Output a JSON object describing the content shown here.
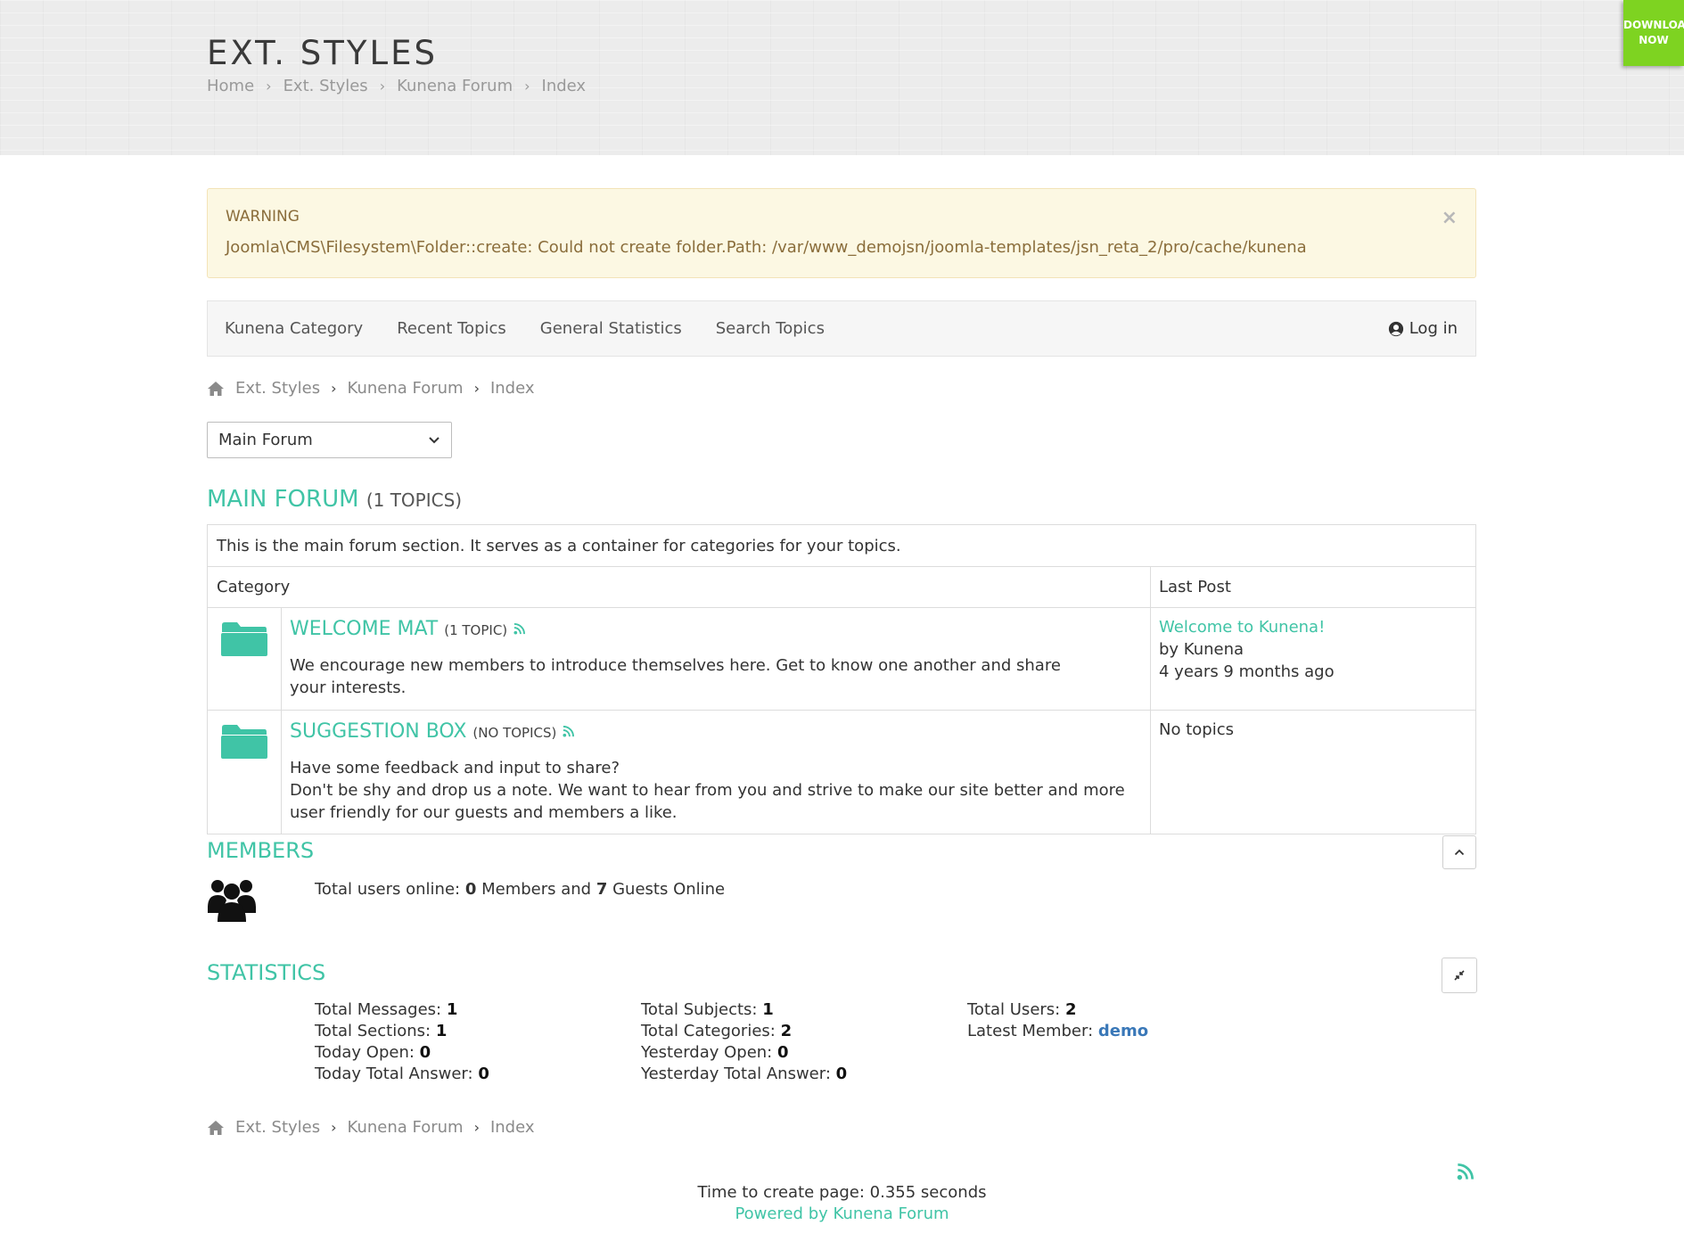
{
  "header": {
    "title": "EXT. STYLES",
    "breadcrumb": [
      "Home",
      "Ext. Styles",
      "Kunena Forum",
      "Index"
    ],
    "download_label_line1": "DOWNLOAD",
    "download_label_line2": "NOW"
  },
  "alert": {
    "heading": "WARNING",
    "message": "Joomla\\CMS\\Filesystem\\Folder::create: Could not create folder.Path: /var/www_demojsn/joomla-templates/jsn_reta_2/pro/cache/kunena",
    "close": "×"
  },
  "nav": {
    "items": [
      "Kunena Category",
      "Recent Topics",
      "General Statistics",
      "Search Topics"
    ],
    "login": "Log in"
  },
  "breadcrumb": [
    "Ext. Styles",
    "Kunena Forum",
    "Index"
  ],
  "category_select": {
    "value": "Main Forum"
  },
  "main_forum": {
    "title": "MAIN FORUM",
    "count": "(1 TOPICS)",
    "description": "This is the main forum section. It serves as a container for categories for your topics.",
    "headers": {
      "category": "Category",
      "last_post": "Last Post"
    },
    "categories": [
      {
        "name": "WELCOME MAT",
        "count": "(1 TOPIC)",
        "description": "We encourage new members to introduce themselves here. Get to know one another and share your interests.",
        "last_post_title": "Welcome to Kunena!",
        "last_post_by": "by Kunena",
        "last_post_time": "4 years 9 months ago"
      },
      {
        "name": "SUGGESTION BOX",
        "count": "(NO TOPICS)",
        "description_line1": "Have some feedback and input to share?",
        "description_line2": "Don't be shy and drop us a note. We want to hear from you and strive to make our site better and more user friendly for our guests and members a like.",
        "last_post_none": "No topics"
      }
    ]
  },
  "members": {
    "title": "MEMBERS",
    "text_prefix": "Total users online:",
    "members_count": "0",
    "text_mid": "Members and",
    "guests_count": "7",
    "text_suffix": "Guests Online"
  },
  "statistics": {
    "title": "STATISTICS",
    "col1": [
      {
        "label": "Total Messages:",
        "value": "1"
      },
      {
        "label": "Total Sections:",
        "value": "1"
      },
      {
        "label": "Today Open:",
        "value": "0"
      },
      {
        "label": "Today Total Answer:",
        "value": "0"
      }
    ],
    "col2": [
      {
        "label": "Total Subjects:",
        "value": "1"
      },
      {
        "label": "Total Categories:",
        "value": "2"
      },
      {
        "label": "Yesterday Open:",
        "value": "0"
      },
      {
        "label": "Yesterday Total Answer:",
        "value": "0"
      }
    ],
    "col3": [
      {
        "label": "Total Users:",
        "value": "2"
      },
      {
        "label": "Latest Member:",
        "value": "demo"
      }
    ]
  },
  "footer": {
    "time": "Time to create page: 0.355 seconds",
    "powered": "Powered by Kunena Forum"
  },
  "colors": {
    "accent": "#40c4a6",
    "download": "#7ed321",
    "warning_bg": "#fcf8e3",
    "link_blue": "#3a78b8"
  }
}
